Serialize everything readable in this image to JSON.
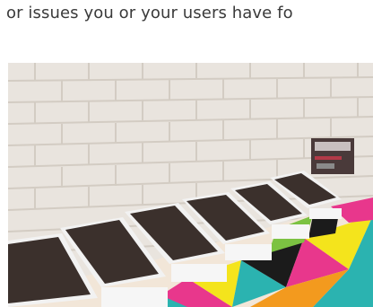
{
  "article": {
    "caption_fragment": "or issues you or your users have fo"
  },
  "photo": {
    "icon": "tablets-on-shelf-photo",
    "colors": {
      "wall": "#e9e4de",
      "mortar": "#cfc8bf",
      "tablet_screen": "#3b302c",
      "tablet_body": "#f2f2f2",
      "shelf_pink": "#e8378c",
      "shelf_yellow": "#f4e41c",
      "shelf_teal": "#2bb3b0",
      "shelf_black": "#1b1b1b"
    }
  }
}
